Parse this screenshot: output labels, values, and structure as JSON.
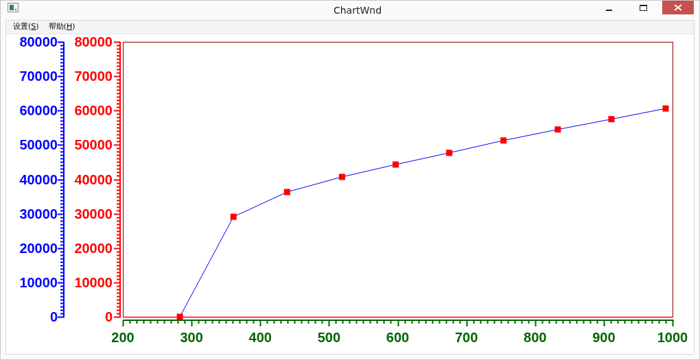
{
  "window": {
    "title": "ChartWnd"
  },
  "menu": [
    {
      "label": "设置(S)"
    },
    {
      "label": "帮助(H)"
    }
  ],
  "chart_data": {
    "type": "line",
    "xlim": [
      200,
      1000
    ],
    "ylim": [
      0,
      80000
    ],
    "xticks": [
      200,
      300,
      400,
      500,
      600,
      700,
      800,
      900,
      1000
    ],
    "yticks": [
      0,
      10000,
      20000,
      30000,
      40000,
      50000,
      60000,
      70000,
      80000
    ],
    "series": [
      {
        "color": "#0000ff",
        "marker": "square",
        "x": [
          283,
          361,
          439,
          519,
          597,
          675,
          754,
          833,
          911,
          990
        ],
        "values": [
          0,
          29100,
          36300,
          40700,
          44300,
          47700,
          51300,
          54500,
          57500,
          60600
        ]
      }
    ]
  },
  "outer_axis": {
    "color": "#0000ff",
    "ticks": [
      "80000",
      "70000",
      "60000",
      "50000",
      "40000",
      "30000",
      "20000",
      "10000",
      "0"
    ]
  },
  "inner_axis": {
    "color": "#ff0000",
    "ticks": [
      "80000",
      "70000",
      "60000",
      "50000",
      "40000",
      "30000",
      "20000",
      "10000",
      "0"
    ]
  }
}
